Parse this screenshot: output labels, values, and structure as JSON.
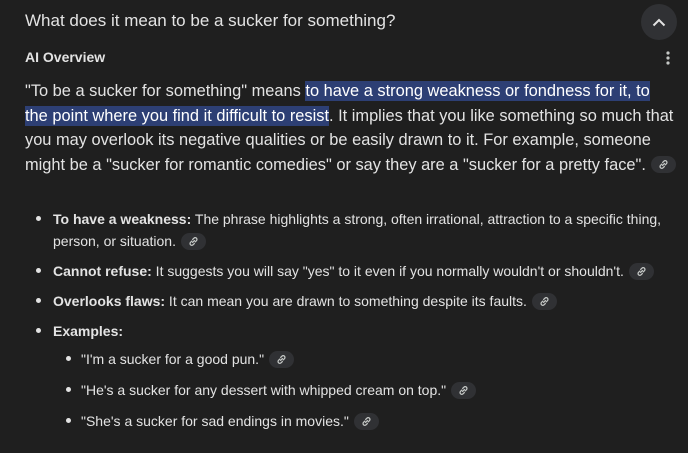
{
  "header": {
    "question": "What does it mean to be a sucker for something?",
    "collapse_icon": "chevron-up-icon"
  },
  "overview": {
    "label": "AI Overview",
    "more_icon": "more-vert-icon",
    "intro_before": "\"To be a sucker for something\" means ",
    "intro_highlight": "to have a strong weakness or fondness for it, to the point where you find it difficult to resist",
    "intro_after": ". It implies that you like something so much that you may overlook its negative qualities or be easily drawn to it. For example, someone might be a \"sucker for romantic comedies\" or say they are a \"sucker for a pretty face\"."
  },
  "bullets": [
    {
      "term": "To have a weakness:",
      "text": " The phrase highlights a strong, often irrational, attraction to a specific thing, person, or situation."
    },
    {
      "term": "Cannot refuse:",
      "text": " It suggests you will say \"yes\" to it even if you normally wouldn't or shouldn't."
    },
    {
      "term": "Overlooks flaws:",
      "text": " It can mean you are drawn to something despite its faults."
    },
    {
      "term": "Examples:",
      "text": ""
    }
  ],
  "examples": [
    "\"I'm a sucker for a good pun.\"",
    "\"He's a sucker for any dessert with whipped cream on top.\"",
    "\"She's a sucker for sad endings in movies.\""
  ],
  "colors": {
    "background": "#1f1f1f",
    "highlight": "#2d3f74",
    "chip": "#303134",
    "text": "#e3e3e3"
  }
}
